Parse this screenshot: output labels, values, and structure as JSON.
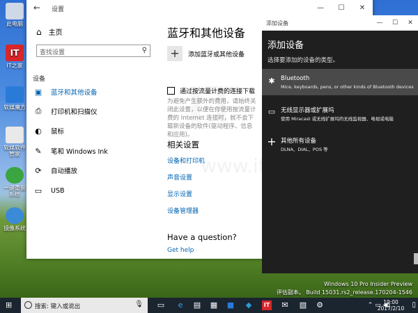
{
  "desktop": {
    "icons": [
      {
        "label": "此电脑",
        "color": "#cfd8e6"
      },
      {
        "label": "IT之家",
        "color": "#d8262b",
        "glyph": "IT"
      },
      {
        "label": "软媒魔方",
        "color": "#2a7bd8"
      },
      {
        "label": "软媒软件管家",
        "color": "#e9e9e9"
      },
      {
        "label": "一键重装系统",
        "color": "#3aa541"
      },
      {
        "label": "镜像系统",
        "color": "#3a8ad8"
      }
    ],
    "watermark_line1": "Windows 10 Pro Insider Preview",
    "watermark_line2": "评估副本。 Build 15031.rs2_release.170204-1546"
  },
  "settings": {
    "title": "设置",
    "back_icon": "←",
    "min": "—",
    "max": "☐",
    "close": "✕",
    "home_label": "主页",
    "search_placeholder": "查找设置",
    "section_label": "设备",
    "nav_items": [
      {
        "label": "蓝牙和其他设备",
        "icon": "bluetooth-icon",
        "glyph": "▣"
      },
      {
        "label": "打印机和扫描仪",
        "icon": "printer-icon",
        "glyph": "⎙"
      },
      {
        "label": "鼠标",
        "icon": "mouse-icon",
        "glyph": "🖱"
      },
      {
        "label": "笔和 Windows Ink",
        "icon": "pen-icon",
        "glyph": "✎"
      },
      {
        "label": "自动播放",
        "icon": "autoplay-icon",
        "glyph": "⟳"
      },
      {
        "label": "USB",
        "icon": "usb-icon",
        "glyph": "▭"
      }
    ],
    "page_title": "蓝牙和其他设备",
    "add_device_label": "添加蓝牙或其他设备",
    "metered_label": "通过按流量计费的连接下载",
    "metered_desc": "为避免产生额外的费用，请始终关闭此设置，以便在你使用按流量计费的 Internet 连接时，就不会下载新设备的软件(驱动程序、信息和应用)。",
    "related_heading": "相关设置",
    "related_links": [
      "设备和打印机",
      "声音设置",
      "显示设置",
      "设备管理器"
    ],
    "question_heading": "Have a question?",
    "get_help": "Get help"
  },
  "dialog": {
    "title": "添加设备",
    "heading": "添加设备",
    "subheading": "选择要添加的设备的类型。",
    "options": [
      {
        "icon": "bluetooth-icon",
        "glyph": "✱",
        "title": "Bluetooth",
        "desc": "Mice, keyboards, pens, or other kinds of Bluetooth devices",
        "selected": true
      },
      {
        "icon": "display-icon",
        "glyph": "▭",
        "title": "无线显示器或扩展坞",
        "desc": "使用 Miracast 或无线扩展坞的无线监视器、电视或电脑",
        "selected": false
      },
      {
        "icon": "plus-icon",
        "glyph": "+",
        "title": "其他所有设备",
        "desc": "DLNA、DIAL、POS 等",
        "selected": false
      }
    ]
  },
  "taskbar": {
    "search_text": "搜索: 键入或说出",
    "time": "10:00",
    "date": "2017/2/10"
  }
}
